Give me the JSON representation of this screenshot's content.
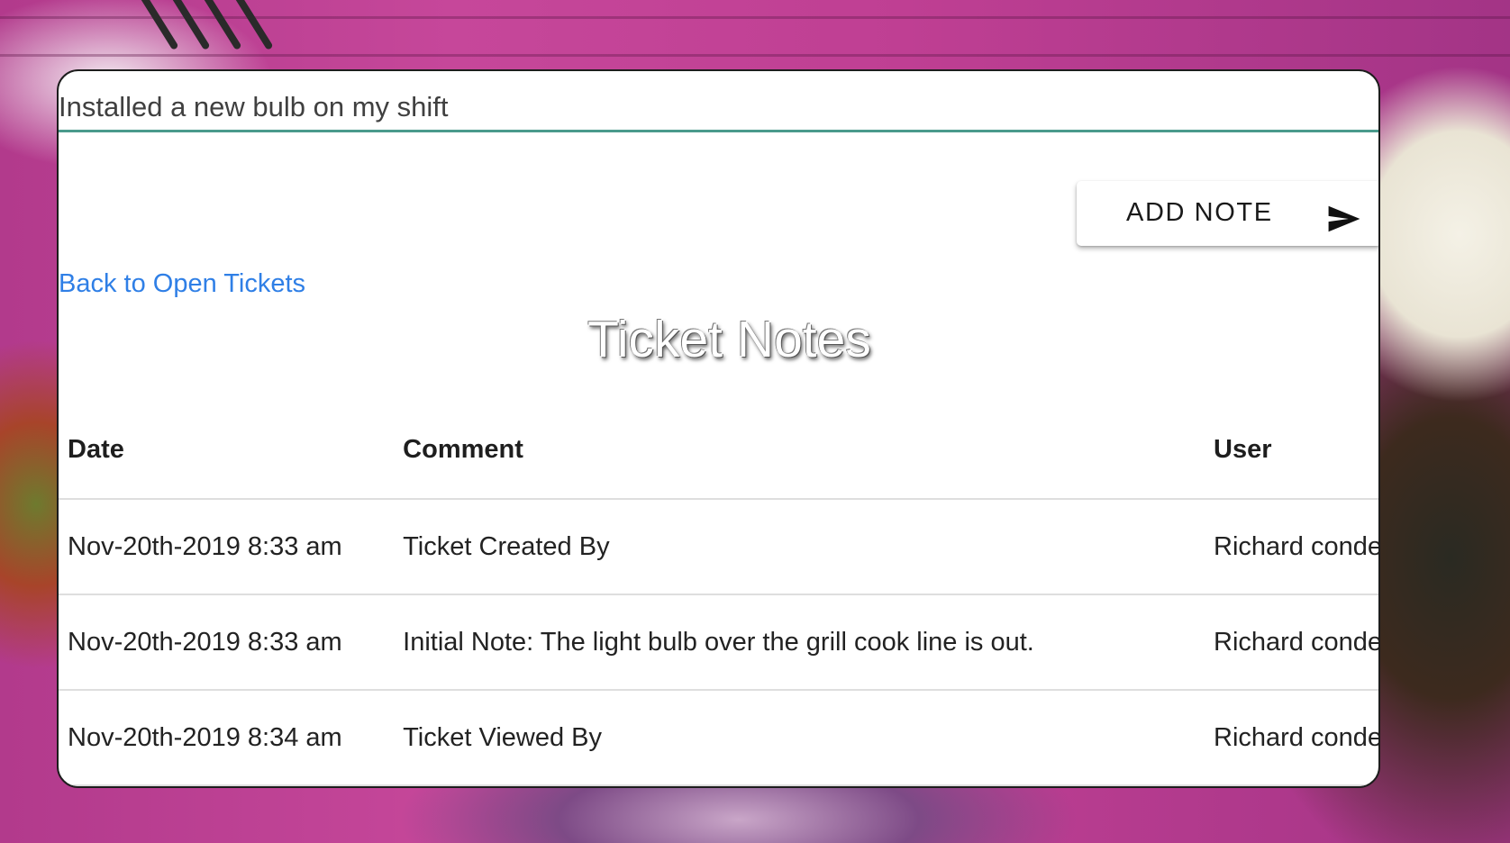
{
  "note_input": {
    "value": "Installed a new bulb on my shift",
    "placeholder": ""
  },
  "actions": {
    "add_note_label": "ADD NOTE",
    "add_note_icon": "send-icon"
  },
  "navigation": {
    "back_link_label": "Back to Open Tickets"
  },
  "page_title": "Ticket Notes",
  "notes_table": {
    "headers": {
      "date": "Date",
      "comment": "Comment",
      "user": "User"
    },
    "rows": [
      {
        "date": "Nov-20th-2019 8:33 am",
        "comment": "Ticket Created By",
        "user": "Richard conde"
      },
      {
        "date": "Nov-20th-2019 8:33 am",
        "comment": "Initial Note: The light bulb over the grill cook line is out.",
        "user": "Richard conde"
      },
      {
        "date": "Nov-20th-2019 8:34 am",
        "comment": "Ticket Viewed By",
        "user": "Richard conde"
      }
    ]
  },
  "colors": {
    "accent_underline": "#4a9a8c",
    "link": "#2f7fe6",
    "background_magenta": "#c6479a"
  }
}
